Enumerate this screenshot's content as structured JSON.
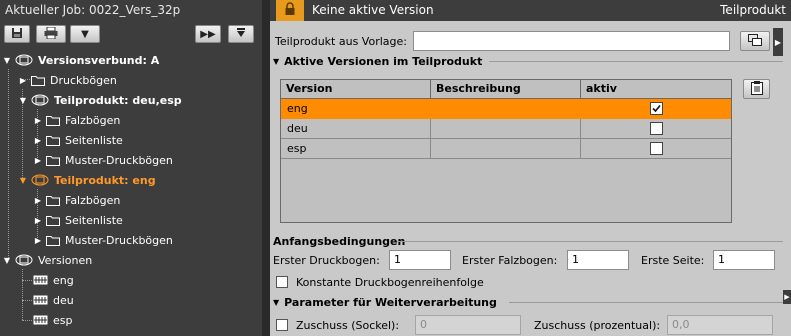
{
  "left_pane": {
    "job_title": "Aktueller Job: 0022_Vers_32p",
    "toolbar": {
      "save_icon": "save-icon",
      "print_icon": "print-icon",
      "dropdown_icon": "chevron-down-icon",
      "forward_icon": "fast-forward-icon",
      "collapse_icon": "collapse-down-icon"
    },
    "tree": {
      "versionsverbund": "Versionsverbund: A",
      "druckboegen": "Druckbögen",
      "tp_deu_esp": "Teilprodukt: deu,esp",
      "falzboegen_1": "Falzbögen",
      "seitenliste_1": "Seitenliste",
      "muster_1": "Muster-Druckbögen",
      "tp_eng": "Teilprodukt: eng",
      "falzboegen_2": "Falzbögen",
      "seitenliste_2": "Seitenliste",
      "muster_2": "Muster-Druckbögen",
      "versionen": "Versionen",
      "v_eng": "eng",
      "v_deu": "deu",
      "v_esp": "esp"
    },
    "colors": {
      "active": "#ff9a2a",
      "background": "#3d3d3d"
    }
  },
  "right_pane": {
    "header": {
      "lock_icon": "lock-icon",
      "status": "Keine aktive Version",
      "area": "Teilprodukt"
    },
    "vorlage_label": "Teilprodukt aus Vorlage:",
    "vorlage_value": "",
    "aktive_versionen_title": "Aktive Versionen im Teilprodukt",
    "table": {
      "columns": [
        "Version",
        "Beschreibung",
        "aktiv"
      ],
      "rows": [
        {
          "version": "eng",
          "beschreibung": "",
          "aktiv": true,
          "selected": true
        },
        {
          "version": "deu",
          "beschreibung": "",
          "aktiv": false,
          "selected": false
        },
        {
          "version": "esp",
          "beschreibung": "",
          "aktiv": false,
          "selected": false
        }
      ]
    },
    "anfangsbedingungen": {
      "title": "Anfangsbedingungen",
      "erster_druckbogen_label": "Erster Druckbogen:",
      "erster_druckbogen": "1",
      "erster_falzbogen_label": "Erster Falzbogen:",
      "erster_falzbogen": "1",
      "erste_seite_label": "Erste Seite:",
      "erste_seite": "1",
      "konstante_label": "Konstante Druckbogenreihenfolge"
    },
    "parameter": {
      "title": "Parameter für Weiterverarbeitung",
      "zuschuss_sockel_label": "Zuschuss (Sockel):",
      "zuschuss_sockel": "0",
      "zuschuss_proz_label": "Zuschuss (prozentual):",
      "zuschuss_proz": "0,0"
    },
    "colors": {
      "selection": "#ff8c00",
      "lock": "#e89a1c"
    }
  }
}
